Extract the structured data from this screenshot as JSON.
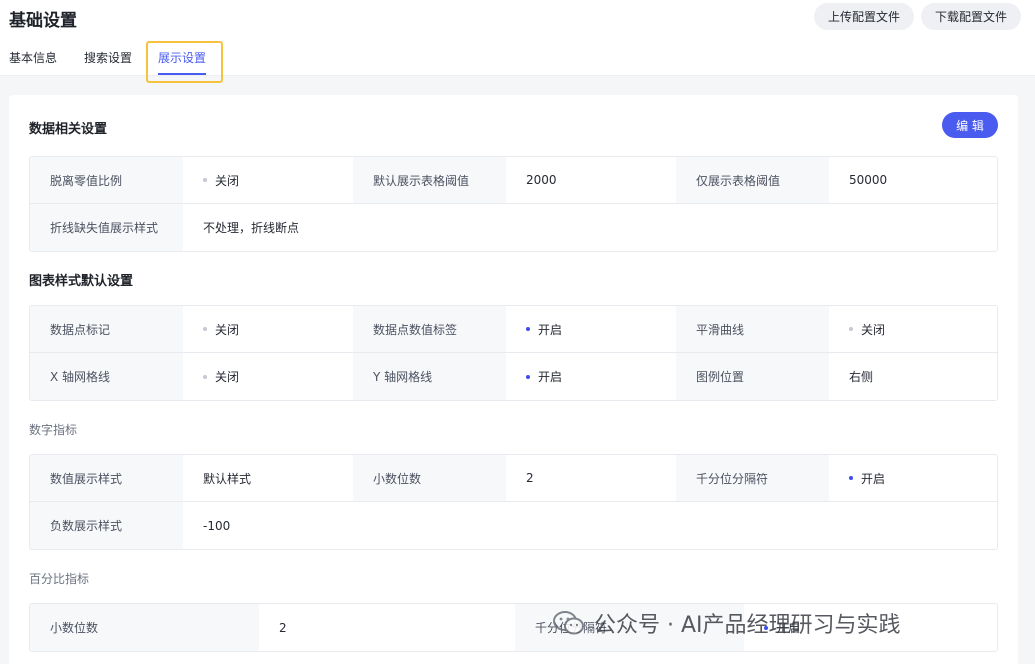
{
  "header": {
    "title": "基础设置",
    "upload_label": "上传配置文件",
    "download_label": "下载配置文件"
  },
  "tabs": [
    {
      "label": "基本信息",
      "active": false
    },
    {
      "label": "搜索设置",
      "active": false
    },
    {
      "label": "展示设置",
      "active": true
    }
  ],
  "colors": {
    "accent": "#4a5bf0",
    "highlight": "#f7c33e",
    "on_dot": "#3b4ef0",
    "off_dot": "#c4c8d0"
  },
  "sections": {
    "data": {
      "title": "数据相关设置",
      "edit_label": "编 辑",
      "rows": [
        [
          {
            "label": "脱离零值比例",
            "value": "关闭",
            "status": "off"
          },
          {
            "label": "默认展示表格阈值",
            "value": "2000"
          },
          {
            "label": "仅展示表格阈值",
            "value": "50000"
          }
        ],
        [
          {
            "label": "折线缺失值展示样式",
            "value": "不处理，折线断点"
          }
        ]
      ]
    },
    "chart": {
      "title": "图表样式默认设置",
      "rows": [
        [
          {
            "label": "数据点标记",
            "value": "关闭",
            "status": "off"
          },
          {
            "label": "数据点数值标签",
            "value": "开启",
            "status": "on"
          },
          {
            "label": "平滑曲线",
            "value": "关闭",
            "status": "off"
          }
        ],
        [
          {
            "label": "X 轴网格线",
            "value": "关闭",
            "status": "off"
          },
          {
            "label": "Y 轴网格线",
            "value": "开启",
            "status": "on"
          },
          {
            "label": "图例位置",
            "value": "右侧"
          }
        ]
      ]
    },
    "number": {
      "title": "数字指标",
      "rows": [
        [
          {
            "label": "数值展示样式",
            "value": "默认样式"
          },
          {
            "label": "小数位数",
            "value": "2"
          },
          {
            "label": "千分位分隔符",
            "value": "开启",
            "status": "on"
          }
        ],
        [
          {
            "label": "负数展示样式",
            "value": "-100"
          }
        ]
      ]
    },
    "percent": {
      "title": "百分比指标",
      "rows": [
        [
          {
            "label": "小数位数",
            "value": "2"
          },
          {
            "label": "千分位分隔符",
            "value": "开启",
            "status": "on"
          }
        ]
      ]
    }
  },
  "watermark": {
    "text": "公众号 · AI产品经理研习与实践",
    "icon": "wechat-icon"
  }
}
